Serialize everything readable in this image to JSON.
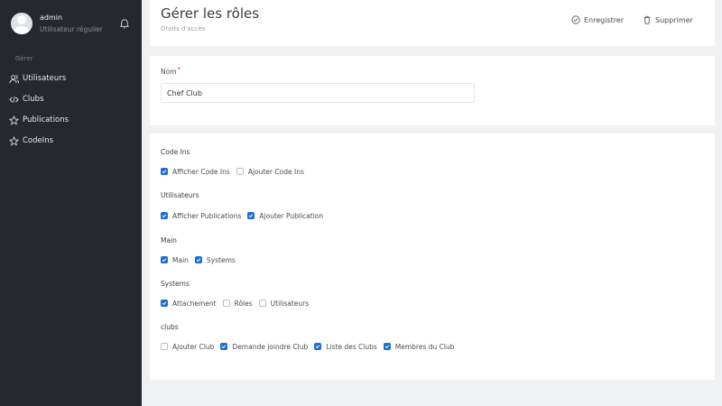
{
  "sidebar": {
    "user_name": "admin",
    "user_role": "Utilisateur régulier",
    "section_label": "Gérer",
    "items": [
      {
        "label": "Utilisateurs",
        "icon": "users-icon"
      },
      {
        "label": "Clubs",
        "icon": "code-icon"
      },
      {
        "label": "Publications",
        "icon": "star-icon"
      },
      {
        "label": "CodeIns",
        "icon": "star-icon"
      }
    ]
  },
  "header": {
    "title": "Gérer les rôles",
    "subtitle": "Droits d'accès",
    "save_label": "Enregistrer",
    "delete_label": "Supprimer"
  },
  "form": {
    "name_label": "Nom",
    "required_mark": "*",
    "name_value": "Chef Club"
  },
  "permissions": [
    {
      "title": "Code Ins",
      "items": [
        {
          "label": "Afficher Code Ins",
          "checked": true
        },
        {
          "label": "Ajouter Code Ins",
          "checked": false
        }
      ]
    },
    {
      "title": "Utilisateurs",
      "items": [
        {
          "label": "Afficher Publications",
          "checked": true
        },
        {
          "label": "Ajouter Publication",
          "checked": true
        }
      ]
    },
    {
      "title": "Main",
      "items": [
        {
          "label": "Main",
          "checked": true
        },
        {
          "label": "Systems",
          "checked": true
        }
      ]
    },
    {
      "title": "Systems",
      "items": [
        {
          "label": "Attachement",
          "checked": true
        },
        {
          "label": "Rôles",
          "checked": false
        },
        {
          "label": "Utilisateurs",
          "checked": false
        }
      ]
    },
    {
      "title": "clubs",
      "items": [
        {
          "label": "Ajouter Club",
          "checked": false
        },
        {
          "label": "Demande joindre Club",
          "checked": true
        },
        {
          "label": "Liste des Clubs",
          "checked": true
        },
        {
          "label": "Membres du Club",
          "checked": true
        }
      ]
    }
  ],
  "colors": {
    "sidebar_bg": "#25282c",
    "accent": "#1d6fd1",
    "required": "#e2363b"
  }
}
